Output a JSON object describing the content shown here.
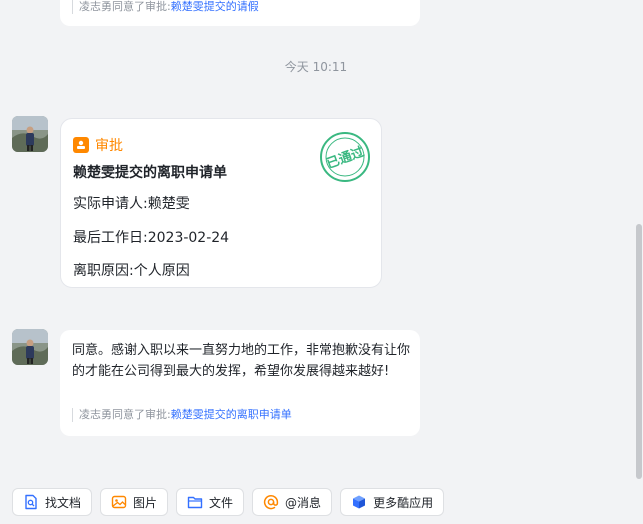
{
  "top_message": {
    "quote_prefix": "凌志勇同意了审批:",
    "quote_link": "赖楚雯提交的请假"
  },
  "time_divider": "今天 10:11",
  "approval_card": {
    "header_label": "审批",
    "title": "赖楚雯提交的离职申请单",
    "stamp_text": "已通过",
    "fields": [
      {
        "key": "实际申请人:",
        "value": "赖楚雯"
      },
      {
        "key": "最后工作日:",
        "value": "2023-02-24"
      },
      {
        "key": "离职原因:",
        "value": "个人原因"
      }
    ]
  },
  "reply_message": {
    "text": "同意。感谢入职以来一直努力地的工作，非常抱歉没有让你的才能在公司得到最大的发挥，希望你发展得越来越好!",
    "quote_prefix": "凌志勇同意了审批:",
    "quote_link": "赖楚雯提交的离职申请单"
  },
  "toolbar": {
    "items": [
      {
        "label": "找文档",
        "icon": "search-doc-icon",
        "color": "#3370ff"
      },
      {
        "label": "图片",
        "icon": "image-icon",
        "color": "#ff8800"
      },
      {
        "label": "文件",
        "icon": "folder-icon",
        "color": "#3370ff"
      },
      {
        "label": "@消息",
        "icon": "at-icon",
        "color": "#ff8800"
      },
      {
        "label": "更多酷应用",
        "icon": "app-cube-icon",
        "color": "#3370ff"
      }
    ]
  },
  "colors": {
    "accent_orange": "#ff8800",
    "link_blue": "#3370ff",
    "stamp_green": "#3ab881"
  }
}
